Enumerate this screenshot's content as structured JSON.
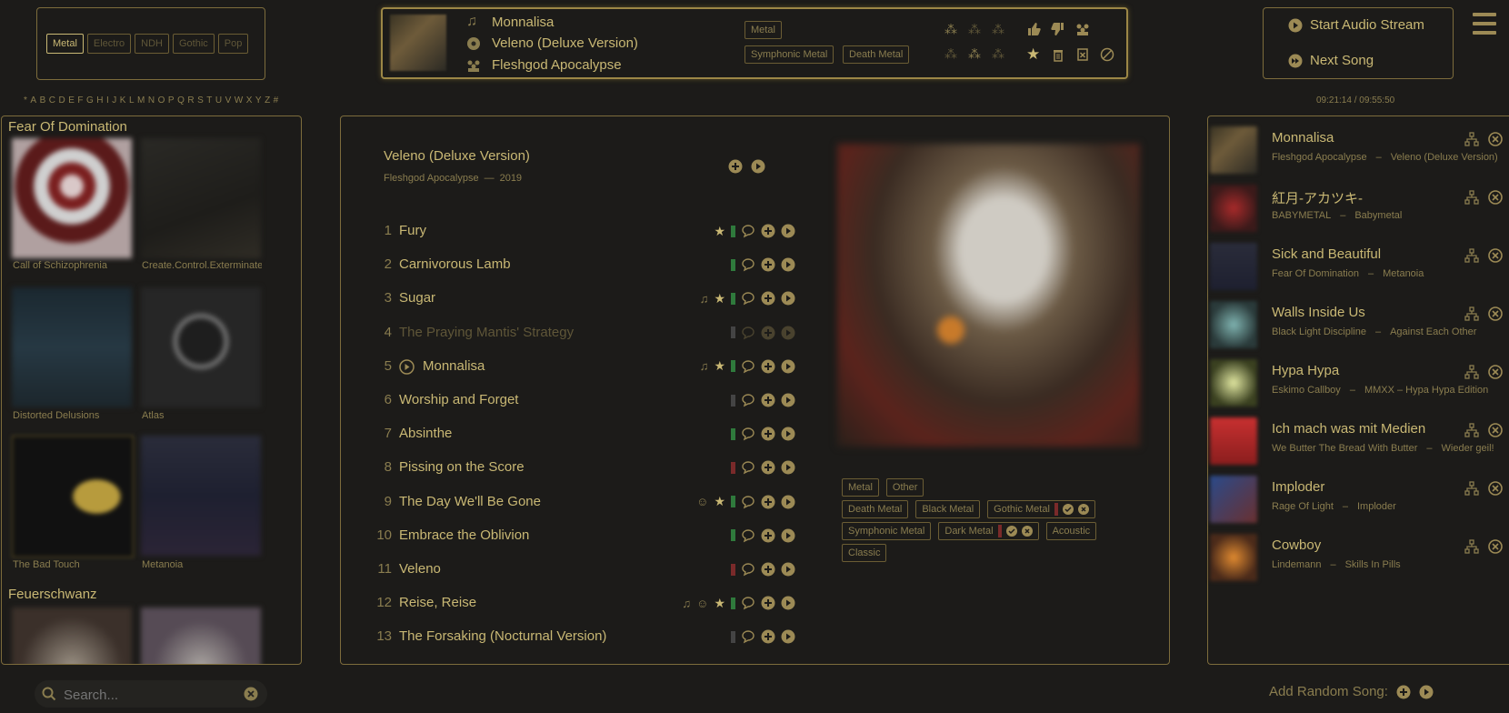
{
  "genre_filter": [
    "Metal",
    "Electro",
    "NDH",
    "Gothic",
    "Pop"
  ],
  "now_playing": {
    "title": "Monnalisa",
    "album": "Veleno (Deluxe Version)",
    "artist": "Fleshgod Apocalypse",
    "tags": [
      "Metal",
      "Symphonic Metal",
      "Death Metal"
    ]
  },
  "stream": {
    "start_label": "Start Audio Stream",
    "next_label": "Next Song"
  },
  "time": "09:21:14 / 09:55:50",
  "alpha": [
    "*",
    "A",
    "B",
    "C",
    "D",
    "E",
    "F",
    "G",
    "H",
    "I",
    "J",
    "K",
    "L",
    "M",
    "N",
    "O",
    "P",
    "Q",
    "R",
    "S",
    "T",
    "U",
    "V",
    "W",
    "X",
    "Y",
    "Z",
    "#"
  ],
  "library": {
    "artists": [
      {
        "name": "Fear Of Domination",
        "albums": [
          "Call of Schizophrenia",
          "Create.Control.Exterminate",
          "Distorted Delusions",
          "Atlas",
          "The Bad Touch",
          "Metanoia"
        ]
      },
      {
        "name": "Feuerschwanz",
        "albums": []
      }
    ]
  },
  "album": {
    "title": "Veleno (Deluxe Version)",
    "artist": "Fleshgod Apocalypse",
    "sep": "—",
    "year": "2019",
    "tracks": [
      {
        "n": "1",
        "t": "Fury"
      },
      {
        "n": "2",
        "t": "Carnivorous Lamb"
      },
      {
        "n": "3",
        "t": "Sugar"
      },
      {
        "n": "4",
        "t": "The Praying Mantis' Strategy"
      },
      {
        "n": "5",
        "t": "Monnalisa"
      },
      {
        "n": "6",
        "t": "Worship and Forget"
      },
      {
        "n": "7",
        "t": "Absinthe"
      },
      {
        "n": "8",
        "t": "Pissing on the Score"
      },
      {
        "n": "9",
        "t": "The Day We'll Be Gone"
      },
      {
        "n": "10",
        "t": "Embrace the Oblivion"
      },
      {
        "n": "11",
        "t": "Veleno"
      },
      {
        "n": "12",
        "t": "Reise, Reise"
      },
      {
        "n": "13",
        "t": "The Forsaking (Nocturnal Version)"
      }
    ],
    "tags_row1": [
      "Metal",
      "Other"
    ],
    "tags_row2": [
      "Death Metal",
      "Black Metal",
      "Gothic Metal"
    ],
    "tags_row3": [
      "Symphonic Metal",
      "Dark Metal",
      "Acoustic"
    ],
    "tags_row4": [
      "Classic"
    ]
  },
  "queue": [
    {
      "title": "Monnalisa",
      "artist": "Fleshgod Apocalypse",
      "sep": "–",
      "album": "Veleno (Deluxe Version)"
    },
    {
      "title": "紅月-アカツキ-",
      "artist": "BABYMETAL",
      "sep": "–",
      "album": "Babymetal"
    },
    {
      "title": "Sick and Beautiful",
      "artist": "Fear Of Domination",
      "sep": "–",
      "album": "Metanoia"
    },
    {
      "title": "Walls Inside Us",
      "artist": "Black Light Discipline",
      "sep": "–",
      "album": "Against Each Other"
    },
    {
      "title": "Hypa Hypa",
      "artist": "Eskimo Callboy",
      "sep": "–",
      "album": "MMXX – Hypa Hypa Edition"
    },
    {
      "title": "Ich mach was mit Medien",
      "artist": "We Butter The Bread With Butter",
      "sep": "–",
      "album": "Wieder geil!"
    },
    {
      "title": "Imploder",
      "artist": "Rage Of Light",
      "sep": "–",
      "album": "Imploder"
    },
    {
      "title": "Cowboy",
      "artist": "Lindemann",
      "sep": "–",
      "album": "Skills In Pills"
    }
  ],
  "search": {
    "placeholder": "Search..."
  },
  "random": {
    "label": "Add Random Song:"
  }
}
